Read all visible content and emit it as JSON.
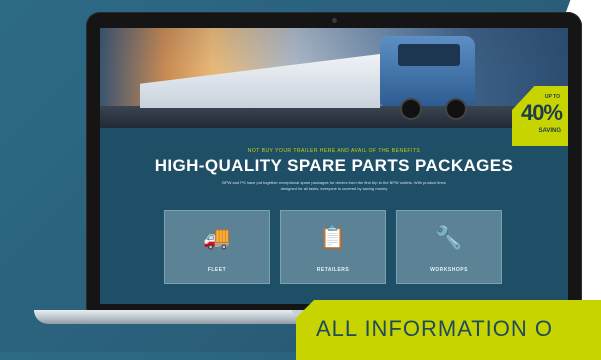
{
  "screen": {
    "kicker": "NOT BUY YOUR TRAILER HERE AND AVAIL OF THE BENEFITS",
    "headline": "HIGH-QUALITY SPARE PARTS PACKAGES",
    "intro": "BPW and PS have put together exceptional spare packages for drivers from the first trip to the BPW outlets. With product lines designed for all tasks, everyone is covered by saving money",
    "badge": {
      "top": "UP TO",
      "value": "40%",
      "bottom": "SAVING"
    },
    "cards": [
      {
        "label": "FLEET",
        "icon": "truck-icon"
      },
      {
        "label": "RETAILERS",
        "icon": "retailer-icon"
      },
      {
        "label": "WORKSHOPS",
        "icon": "wrench-icon"
      }
    ]
  },
  "banner": {
    "text": "ALL INFORMATION O"
  },
  "colors": {
    "accent": "#c8d400",
    "background": "#2a5f7a"
  }
}
